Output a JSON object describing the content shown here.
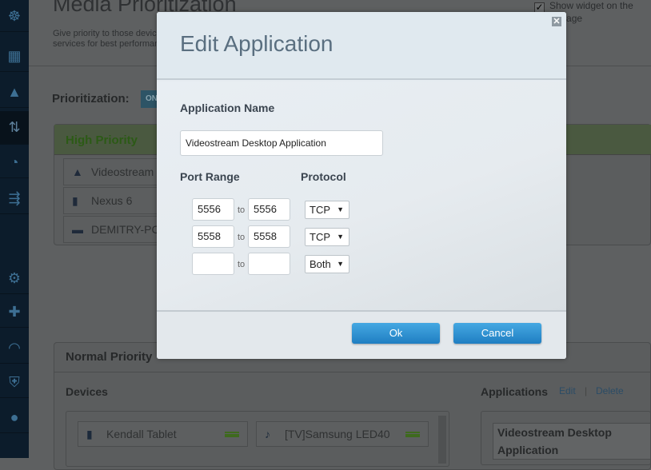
{
  "page": {
    "title": "Media Prioritization",
    "description": "Give priority to those devices and services for best performance",
    "show_widget_label": "Show widget on the home page",
    "show_widget_checked": true,
    "prioritization_label": "Prioritization:",
    "prioritization_state": "ON"
  },
  "high_priority": {
    "title": "High Priority",
    "items": [
      {
        "name": "Videostream Desktop Application",
        "icon": "app-icon"
      },
      {
        "name": "Nexus 6",
        "icon": "phone-icon"
      },
      {
        "name": "DEMITRY-PC",
        "icon": "computer-icon"
      }
    ]
  },
  "normal_priority": {
    "title": "Normal Priority",
    "devices_label": "Devices",
    "applications_label": "Applications",
    "edit_label": "Edit",
    "separator": "|",
    "delete_label": "Delete",
    "devices": [
      {
        "name": "Kendall Tablet",
        "icon": "tablet-icon"
      },
      {
        "name": "[TV]Samsung LED40",
        "icon": "tv-icon"
      }
    ],
    "applications": [
      "Videostream Desktop Application"
    ]
  },
  "modal": {
    "title": "Edit Application",
    "app_name_label": "Application Name",
    "app_name_value": "Videostream Desktop Application",
    "port_range_label": "Port Range",
    "protocol_label": "Protocol",
    "to_label": "to",
    "rows": [
      {
        "from": "5556",
        "to": "5556",
        "protocol": "TCP"
      },
      {
        "from": "5558",
        "to": "5558",
        "protocol": "TCP"
      },
      {
        "from": "",
        "to": "",
        "protocol": "Both"
      }
    ],
    "ok_label": "Ok",
    "cancel_label": "Cancel",
    "close_glyph": "✕"
  },
  "colors": {
    "accent": "#2a8fd4",
    "high_priority_green": "#6fb83f"
  }
}
